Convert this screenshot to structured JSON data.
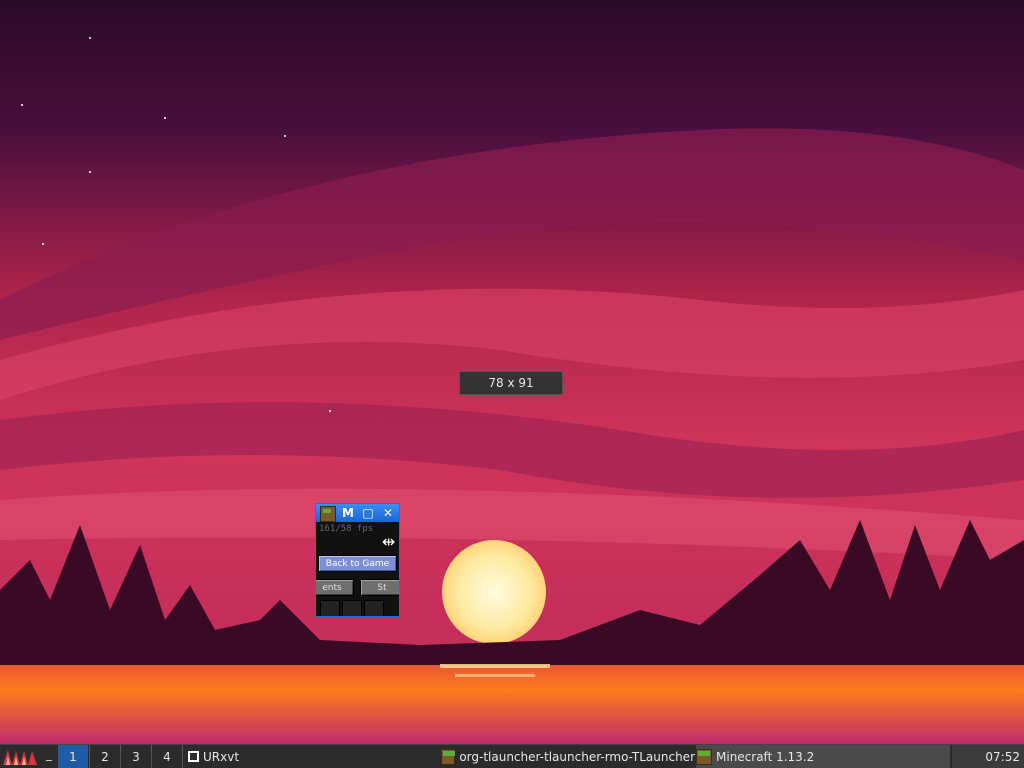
{
  "resize_tooltip": {
    "text": "78 x 91"
  },
  "minecraft_window": {
    "title_buttons": {
      "minimize": "M",
      "maximize": "□",
      "close": "✕"
    },
    "fps_text": "161/58 fps",
    "back_button": "Back to Game",
    "advancements_button": "ents",
    "stats_button": "St"
  },
  "taskbar": {
    "underscore": "_",
    "workspaces": [
      "1",
      "2",
      "3",
      "4"
    ],
    "active_workspace": "1",
    "tasks": [
      {
        "label": "URxvt",
        "icon": "terminal-icon"
      },
      {
        "label": "org-tlauncher-tlauncher-rmo-TLauncher",
        "icon": "minecraft-icon"
      },
      {
        "label": "Minecraft 1.13.2",
        "icon": "minecraft-icon"
      }
    ],
    "clock": "07:52"
  },
  "colors": {
    "sky_top": "#2a0a2a",
    "sky_mid": "#c2284e",
    "sun": "#fff2b0",
    "water": "#ff7a1e",
    "taskbar": "#2b2b2b",
    "active_workspace": "#1e5ca8"
  }
}
